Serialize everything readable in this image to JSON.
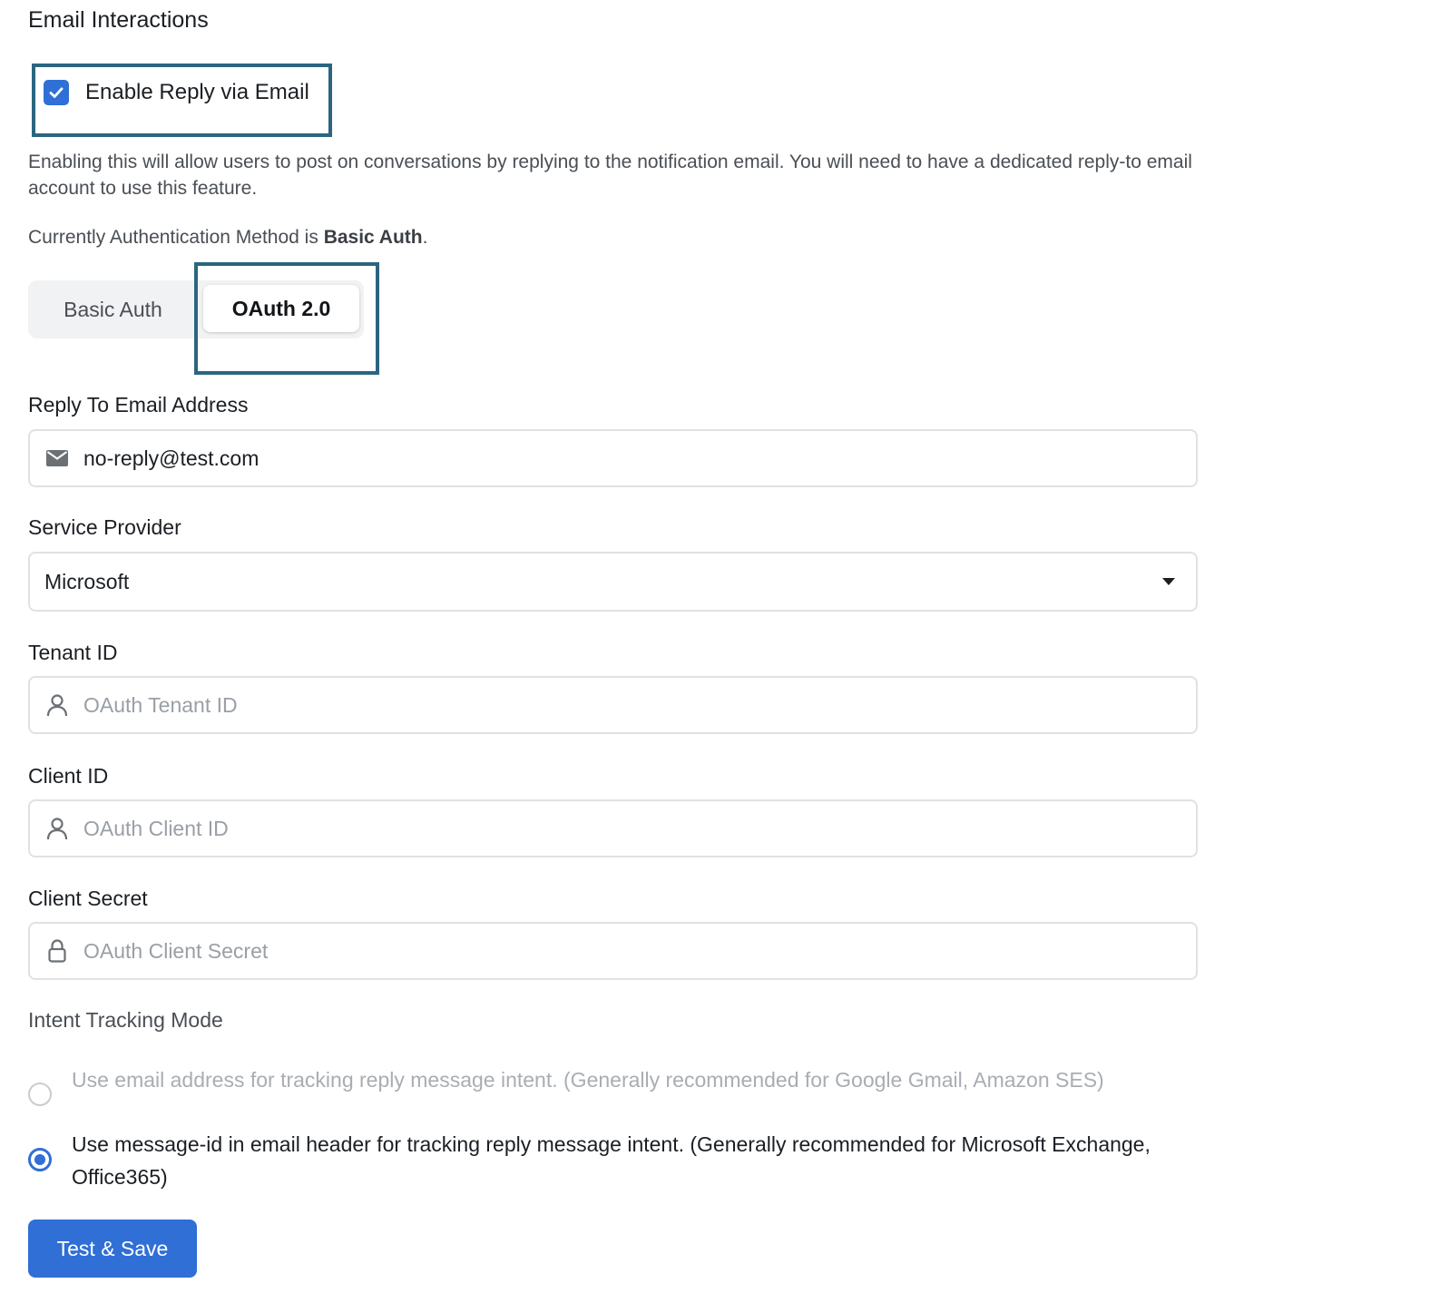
{
  "section": {
    "title": "Email Interactions"
  },
  "reply_via_email": {
    "label": "Enable Reply via Email",
    "checked": true,
    "description": "Enabling this will allow users to post on conversations by replying to the notification email. You will need to have a dedicated reply-to email account to use this feature."
  },
  "auth_status": {
    "prefix": "Currently Authentication Method is ",
    "method": "Basic Auth",
    "suffix": "."
  },
  "auth_tabs": {
    "basic_label": "Basic Auth",
    "oauth_label": "OAuth 2.0",
    "selected": "OAuth 2.0"
  },
  "reply_to": {
    "label": "Reply To Email Address",
    "value": "no-reply@test.com",
    "icon": "mail-icon"
  },
  "service_provider": {
    "label": "Service Provider",
    "value": "Microsoft",
    "icon": "caret-down-icon"
  },
  "tenant_id": {
    "label": "Tenant ID",
    "placeholder": "OAuth Tenant ID",
    "icon": "user-icon"
  },
  "client_id": {
    "label": "Client ID",
    "placeholder": "OAuth Client ID",
    "icon": "user-icon"
  },
  "client_secret": {
    "label": "Client Secret",
    "placeholder": "OAuth Client Secret",
    "icon": "lock-icon"
  },
  "intent_tracking": {
    "label": "Intent Tracking Mode",
    "options": [
      {
        "label": "Use email address for tracking reply message intent. (Generally recommended for Google Gmail, Amazon SES)",
        "selected": false,
        "disabled": true
      },
      {
        "label": "Use message-id in email header for tracking reply message intent. (Generally recommended for Microsoft Exchange, Office365)",
        "selected": true,
        "disabled": false
      }
    ]
  },
  "actions": {
    "test_save_label": "Test & Save"
  },
  "colors": {
    "accent": "#2f6fd6",
    "highlight_border": "#2b6580"
  }
}
